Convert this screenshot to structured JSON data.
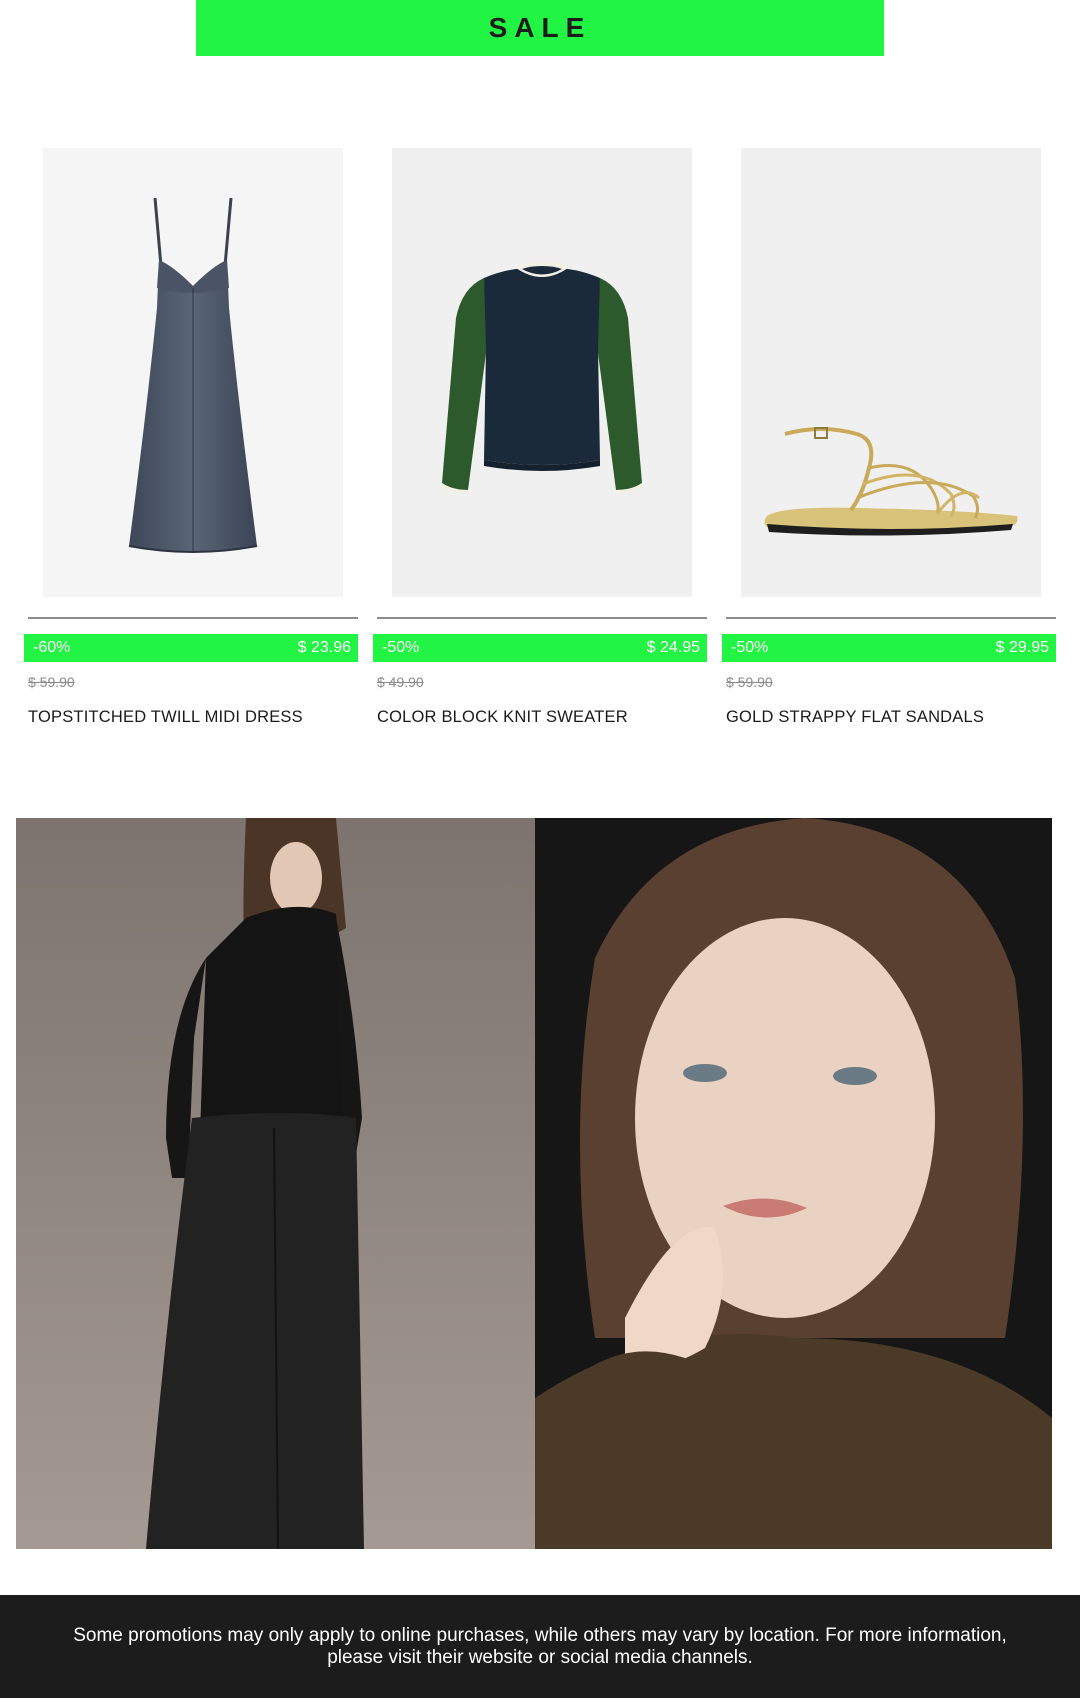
{
  "banner": {
    "label": "SALE"
  },
  "colors": {
    "accent": "#22f443",
    "footer_bg": "#1c1c1c",
    "text": "#1a1a1a",
    "muted": "#8a8a8a"
  },
  "products": [
    {
      "discount": "-60%",
      "price": "$ 23.96",
      "old_price": "$ 59.90",
      "name": "TOPSTITCHED TWILL MIDI DRESS",
      "image": "denim-dress-image"
    },
    {
      "discount": "-50%",
      "price": "$ 24.95",
      "old_price": "$ 49.90",
      "name": "COLOR BLOCK KNIT SWEATER",
      "image": "knit-sweater-image"
    },
    {
      "discount": "-50%",
      "price": "$ 29.95",
      "old_price": "$ 59.90",
      "name": "GOLD STRAPPY FLAT SANDALS",
      "image": "gold-sandals-image"
    }
  ],
  "lookbook": {
    "images": [
      "model-full-length-photo",
      "model-portrait-photo"
    ]
  },
  "footer": {
    "text": "Some promotions may only apply to online purchases, while others may vary by location. For more information, please visit their website or social media channels."
  }
}
